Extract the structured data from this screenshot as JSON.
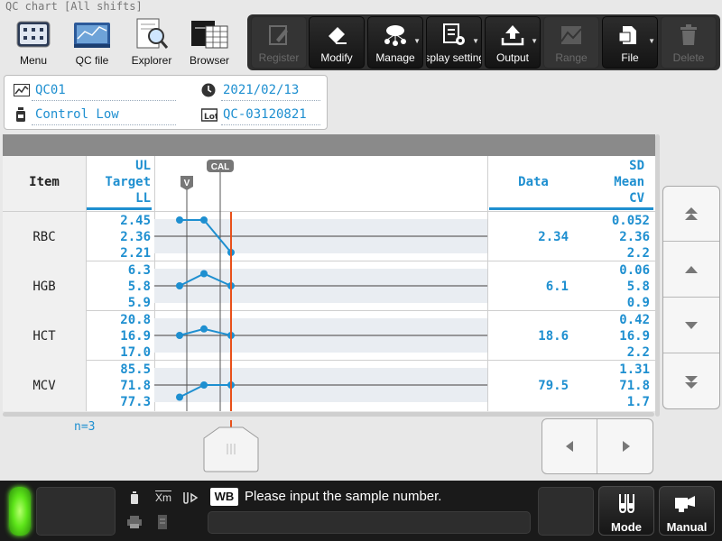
{
  "window": {
    "title": "QC chart [All shifts]"
  },
  "launcher": [
    {
      "label": "Menu",
      "icon": "menu-grid-icon"
    },
    {
      "label": "QC file",
      "icon": "qc-file-icon"
    },
    {
      "label": "Explorer",
      "icon": "explorer-magnifier-icon"
    },
    {
      "label": "Browser",
      "icon": "browser-table-icon"
    }
  ],
  "toolbar": {
    "register": "Register",
    "modify": "Modify",
    "manage": "Manage",
    "display_settings": "Display settings",
    "output": "Output",
    "range": "Range",
    "file": "File",
    "delete": "Delete"
  },
  "info": {
    "qc_name": "QC01",
    "date": "2021/02/13",
    "control_level": "Control Low",
    "lot": "QC-03120821"
  },
  "table": {
    "header": {
      "item": "Item",
      "ul": "UL",
      "target": "Target",
      "ll": "LL",
      "cal_marker": "CAL",
      "v_marker": "V",
      "data": "Data",
      "sd": "SD",
      "mean": "Mean",
      "cv": "CV"
    },
    "rows": [
      {
        "item": "RBC",
        "ul": "2.45",
        "target": "2.36",
        "ll": "2.21",
        "data": "2.34",
        "sd": "0.052",
        "mean": "2.36",
        "cv": "2.2",
        "points": [
          0.2,
          0.2,
          -0.2
        ]
      },
      {
        "item": "HGB",
        "ul": "6.3",
        "target": "5.8",
        "ll": "5.9",
        "data": "6.1",
        "sd": "0.06",
        "mean": "5.8",
        "cv": "0.9",
        "points": [
          0.0,
          0.15,
          0.0
        ]
      },
      {
        "item": "HCT",
        "ul": "20.8",
        "target": "16.9",
        "ll": "17.0",
        "data": "18.6",
        "sd": "0.42",
        "mean": "16.9",
        "cv": "2.2",
        "points": [
          0.0,
          0.08,
          0.0
        ]
      },
      {
        "item": "MCV",
        "ul": "85.5",
        "target": "71.8",
        "ll": "77.3",
        "data": "79.5",
        "sd": "1.31",
        "mean": "71.8",
        "cv": "1.7",
        "points": [
          -0.15,
          0.0,
          0.0
        ]
      }
    ],
    "n_label": "n=3"
  },
  "status": {
    "tag": "WB",
    "message": "Please input the sample number.",
    "xm_label": "Xm",
    "mode_label": "Mode",
    "manual_label": "Manual"
  },
  "colors": {
    "accent": "#1e8fd0",
    "cal_line": "#e8501a",
    "led": "#5ee61a"
  }
}
